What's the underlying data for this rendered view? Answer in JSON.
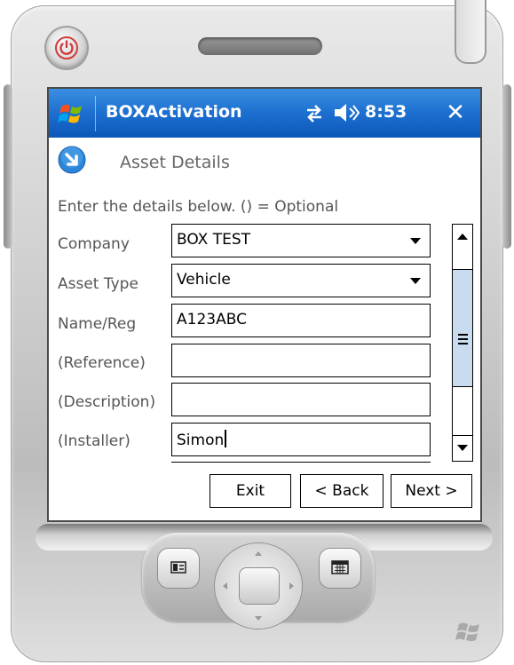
{
  "titlebar": {
    "app_title": "BOXActivation",
    "time": "8:53",
    "close_glyph": "✕",
    "icons": [
      "windows-start-icon",
      "connectivity-icon",
      "volume-icon"
    ]
  },
  "header": {
    "title": "Asset Details",
    "icon": "arrow-down-right-icon"
  },
  "form": {
    "instructions": "Enter the details below. () = Optional",
    "company": {
      "label": "Company",
      "value": "BOX TEST"
    },
    "asset_type": {
      "label": "Asset Type",
      "value": "Vehicle"
    },
    "name_reg": {
      "label": "Name/Reg",
      "value": "A123ABC"
    },
    "reference": {
      "label": "(Reference)",
      "value": ""
    },
    "description": {
      "label": "(Description)",
      "value": ""
    },
    "installer": {
      "label": "(Installer)",
      "value": "Simon"
    }
  },
  "buttons": {
    "exit": "Exit",
    "back": "< Back",
    "next": "Next >"
  },
  "colors": {
    "titlebar": "#1c6fd0",
    "scroll_track": "#c9dcef",
    "power": "#d23a3a"
  }
}
